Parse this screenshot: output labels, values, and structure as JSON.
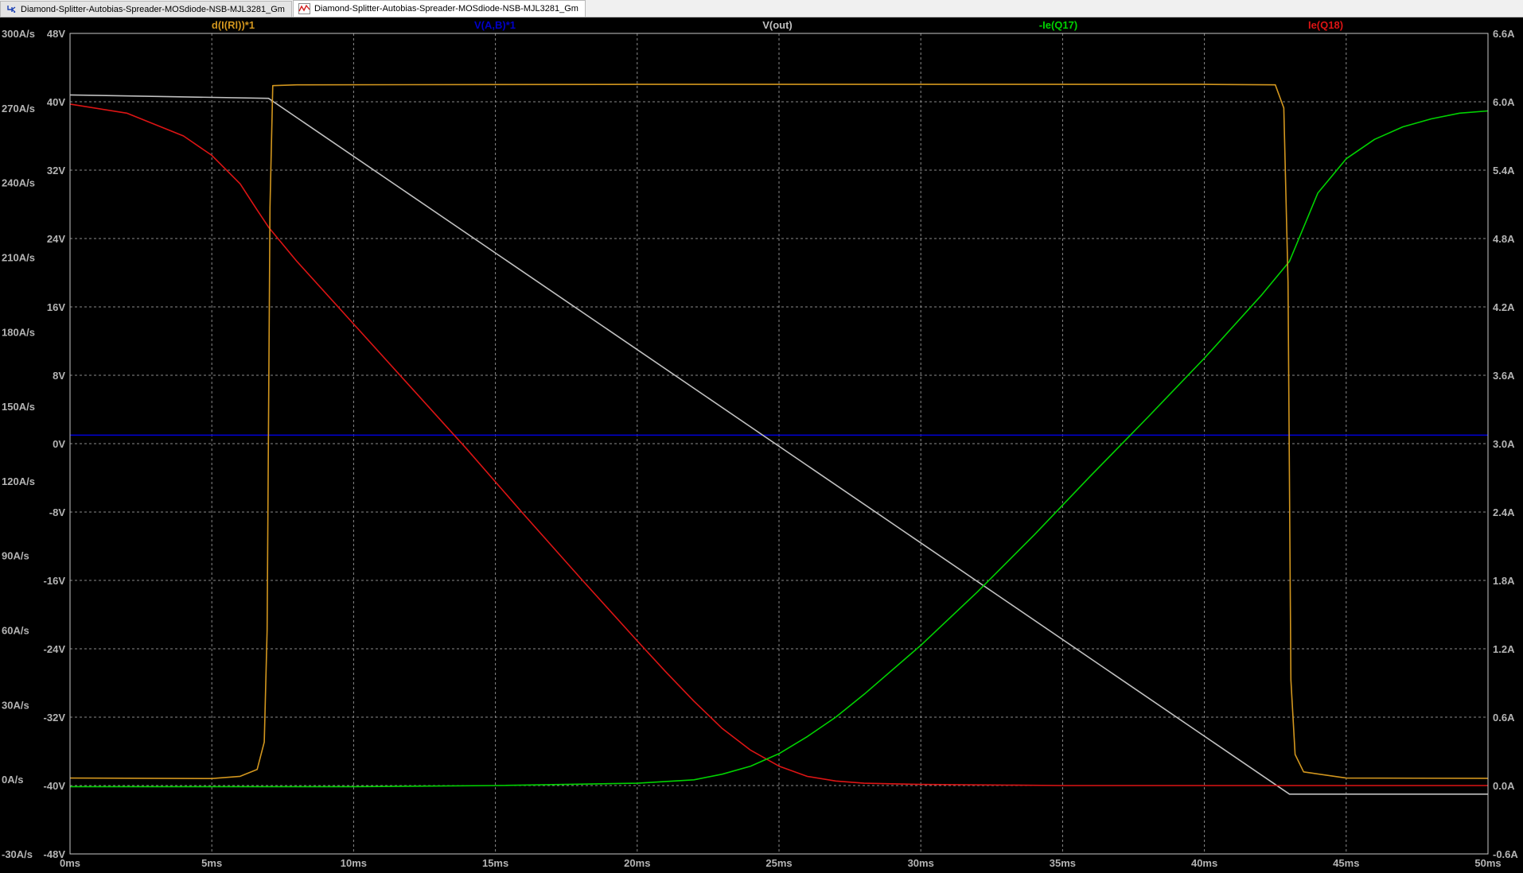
{
  "tabs": [
    {
      "label": "Diamond-Splitter-Autobias-Spreader-MOSdiode-NSB-MJL3281_Gm",
      "icon": "schematic-icon",
      "active": false
    },
    {
      "label": "Diamond-Splitter-Autobias-Spreader-MOSdiode-NSB-MJL3281_Gm",
      "icon": "waveform-icon",
      "active": true
    }
  ],
  "colors": {
    "background": "#000000",
    "grid": "#8a8a8a",
    "axis_text": "#b4b4b4",
    "frame": "#c8c8c8"
  },
  "chart_data": {
    "type": "line",
    "x_ticks": [
      "0ms",
      "5ms",
      "10ms",
      "15ms",
      "20ms",
      "25ms",
      "30ms",
      "35ms",
      "40ms",
      "45ms",
      "50ms"
    ],
    "xlim": [
      0,
      50
    ],
    "grid": true,
    "legend_placement": "top",
    "axes": {
      "left_outer": {
        "ticks": [
          "300A/s",
          "270A/s",
          "240A/s",
          "210A/s",
          "180A/s",
          "150A/s",
          "120A/s",
          "90A/s",
          "60A/s",
          "30A/s",
          "0A/s",
          "-30A/s"
        ],
        "lim": [
          -30,
          300
        ]
      },
      "left_inner": {
        "ticks": [
          "48V",
          "40V",
          "32V",
          "24V",
          "16V",
          "8V",
          "0V",
          "-8V",
          "-16V",
          "-24V",
          "-32V",
          "-40V",
          "-48V"
        ],
        "lim": [
          -48,
          48
        ]
      },
      "right": {
        "ticks": [
          "6.6A",
          "6.0A",
          "5.4A",
          "4.8A",
          "4.2A",
          "3.6A",
          "3.0A",
          "2.4A",
          "1.8A",
          "1.2A",
          "0.6A",
          "0.0A",
          "-0.6A"
        ],
        "lim": [
          -0.6,
          6.6
        ]
      }
    },
    "series": [
      {
        "name": "d(I(Rl))*1",
        "color": "#d2961e",
        "axis": "left_outer",
        "x": [
          0,
          5,
          6,
          6.6,
          6.85,
          6.95,
          7.05,
          7.15,
          8,
          20,
          40,
          42.5,
          42.8,
          42.95,
          43.05,
          43.2,
          43.5,
          45,
          50
        ],
        "y": [
          0.5,
          0.3,
          1.2,
          4,
          15,
          60,
          230,
          279,
          279.3,
          279.5,
          279.5,
          279.3,
          270,
          200,
          40,
          10,
          3,
          0.5,
          0.4
        ]
      },
      {
        "name": "V(A,B)*1",
        "color": "#0000c8",
        "axis": "left_inner",
        "x": [
          0,
          50
        ],
        "y": [
          1.0,
          1.0
        ]
      },
      {
        "name": "V(out)",
        "color": "#c0c0c0",
        "axis": "left_inner",
        "x": [
          0,
          7,
          43,
          50
        ],
        "y": [
          40.8,
          40.4,
          -41.0,
          -41.0
        ]
      },
      {
        "name": "-Ie(Q17)",
        "color": "#00d200",
        "axis": "right",
        "x": [
          0,
          10,
          15,
          20,
          22,
          23,
          24,
          25,
          26,
          27,
          28,
          30,
          32,
          34,
          36,
          38,
          40,
          42,
          43,
          44,
          45,
          46,
          47,
          48,
          49,
          50
        ],
        "y": [
          -0.01,
          -0.01,
          0.0,
          0.02,
          0.05,
          0.1,
          0.17,
          0.28,
          0.43,
          0.6,
          0.8,
          1.23,
          1.7,
          2.2,
          2.72,
          3.23,
          3.75,
          4.3,
          4.6,
          5.2,
          5.5,
          5.67,
          5.78,
          5.85,
          5.9,
          5.92
        ]
      },
      {
        "name": "Ie(Q18)",
        "color": "#dc1414",
        "axis": "right",
        "x": [
          0,
          2,
          4,
          5,
          6,
          6.6,
          7,
          8,
          10,
          12,
          14,
          16,
          18,
          20,
          21,
          22,
          23,
          24,
          25,
          26,
          27,
          28,
          30,
          35,
          50
        ],
        "y": [
          5.98,
          5.9,
          5.7,
          5.53,
          5.28,
          5.05,
          4.9,
          4.6,
          4.05,
          3.5,
          2.95,
          2.38,
          1.82,
          1.27,
          1.0,
          0.74,
          0.5,
          0.31,
          0.17,
          0.08,
          0.04,
          0.02,
          0.01,
          0.0,
          0.0
        ]
      }
    ]
  }
}
